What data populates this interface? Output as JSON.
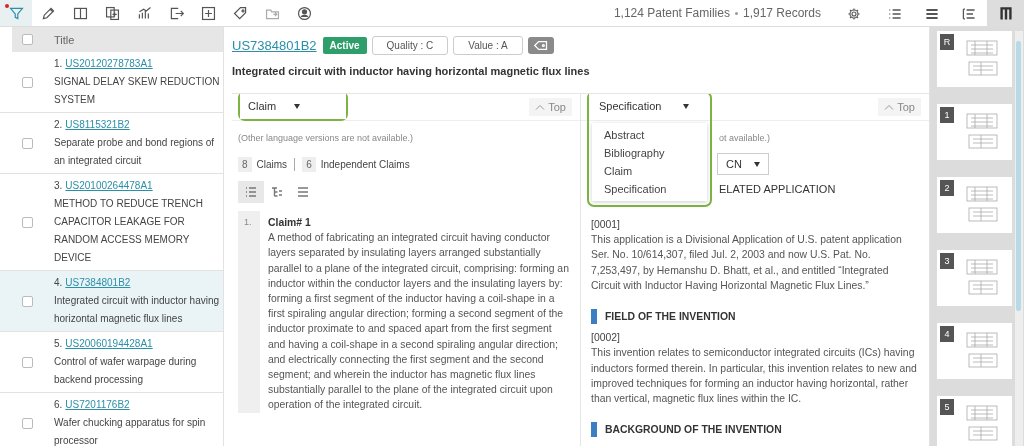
{
  "toolbar": {
    "counts": [
      "1,124 Patent Families",
      "1,917 Records"
    ],
    "view_modes": [
      {
        "kind": "list",
        "selected": false
      },
      {
        "kind": "rows",
        "selected": false
      },
      {
        "kind": "outline",
        "selected": false
      },
      {
        "kind": "columns",
        "selected": true
      }
    ]
  },
  "result_list": {
    "header": "Title",
    "all_checked": false,
    "rows": [
      {
        "number": "1.",
        "patent": "US20120278783A1",
        "title": "SIGNAL DELAY SKEW REDUCTION SYSTEM",
        "checked": false,
        "selected": false
      },
      {
        "number": "2.",
        "patent": "US8115321B2",
        "title": "Separate probe and bond regions of an integrated circuit",
        "checked": false,
        "selected": false
      },
      {
        "number": "3.",
        "patent": "US20100264478A1",
        "title": "METHOD TO REDUCE TRENCH CAPACITOR LEAKAGE FOR RANDOM ACCESS MEMORY DEVICE",
        "checked": false,
        "selected": false
      },
      {
        "number": "4.",
        "patent": "US7384801B2",
        "title": "Integrated circuit with inductor having horizontal magnetic flux lines",
        "checked": false,
        "selected": true
      },
      {
        "number": "5.",
        "patent": "US20060194428A1",
        "title": "Control of wafer warpage during backend processing",
        "checked": false,
        "selected": false
      },
      {
        "number": "6.",
        "patent": "US7201176B2",
        "title": "Wafer chucking apparatus for spin processor",
        "checked": false,
        "selected": false
      }
    ]
  },
  "detail": {
    "patent": "US7384801B2",
    "status": "Active",
    "quality": "Quality : C",
    "value": "Value : A",
    "title": "Integrated circuit with inductor having horizontal magnetic flux lines",
    "claim_pane": {
      "section": "Claim",
      "top": "Top",
      "note": "(Other language versions are not available.)",
      "claims_count": "8",
      "claims_label": "Claims",
      "independent_count": "6",
      "independent_label": "Independent Claims",
      "view_toggles": [
        {
          "kind": "list",
          "selected": true
        },
        {
          "kind": "tree",
          "selected": false
        },
        {
          "kind": "plain",
          "selected": false
        }
      ],
      "claims": [
        {
          "number": "1.",
          "heading": "Claim# 1",
          "text": "A method of fabricating an integrated circuit having conductor layers separated by insulating layers arranged substantially parallel to a plane of the integrated circuit, comprising: forming an inductor within the conductor layers and the insulating layers by: forming a first segment of the inductor having a coil-shape in a first spiraling angular direction; forming a second segment of the inductor proximate to and spaced apart from the first segment and having a coil-shape in a second spiraling angular direction; and electrically connecting the first segment and the second segment; and wherein the inductor has magnetic flux lines substantially parallel to the plane of the integrated circuit upon operation of the integrated circuit."
        }
      ]
    },
    "spec_pane": {
      "section": "Specification",
      "menu_open": true,
      "menu": [
        "Abstract",
        "Bibliography",
        "Claim",
        "Specification"
      ],
      "top": "Top",
      "note_fragment": "ot available.)",
      "language_fragment": "CN",
      "heading_fragment": "ELATED APPLICATION",
      "sections": [
        {
          "kind": "paragraph",
          "label": "[0001]",
          "text": "This application is a Divisional Application of U.S. patent application Ser. No. 10/614,307, filed Jul. 2, 2003 and now U.S. Pat. No. 7,253,497, by Hemanshu D. Bhatt, et al., and entitled “Integrated Circuit with Inductor Having Horizontal Magnetic Flux Lines.”"
        },
        {
          "kind": "heading",
          "text": "FIELD OF THE INVENTION"
        },
        {
          "kind": "paragraph",
          "label": "[0002]",
          "text": "This invention relates to semiconductor integrated circuits (ICs) having inductors formed therein. In particular, this invention relates to new and improved techniques for forming an inductor having horizontal, rather than vertical, magnetic flux lines within the IC."
        },
        {
          "kind": "heading",
          "text": "BACKGROUND OF THE INVENTION"
        }
      ]
    }
  },
  "thumbnails": [
    {
      "label": "R"
    },
    {
      "label": "1"
    },
    {
      "label": "2"
    },
    {
      "label": "3"
    },
    {
      "label": "4"
    },
    {
      "label": "5"
    }
  ]
}
